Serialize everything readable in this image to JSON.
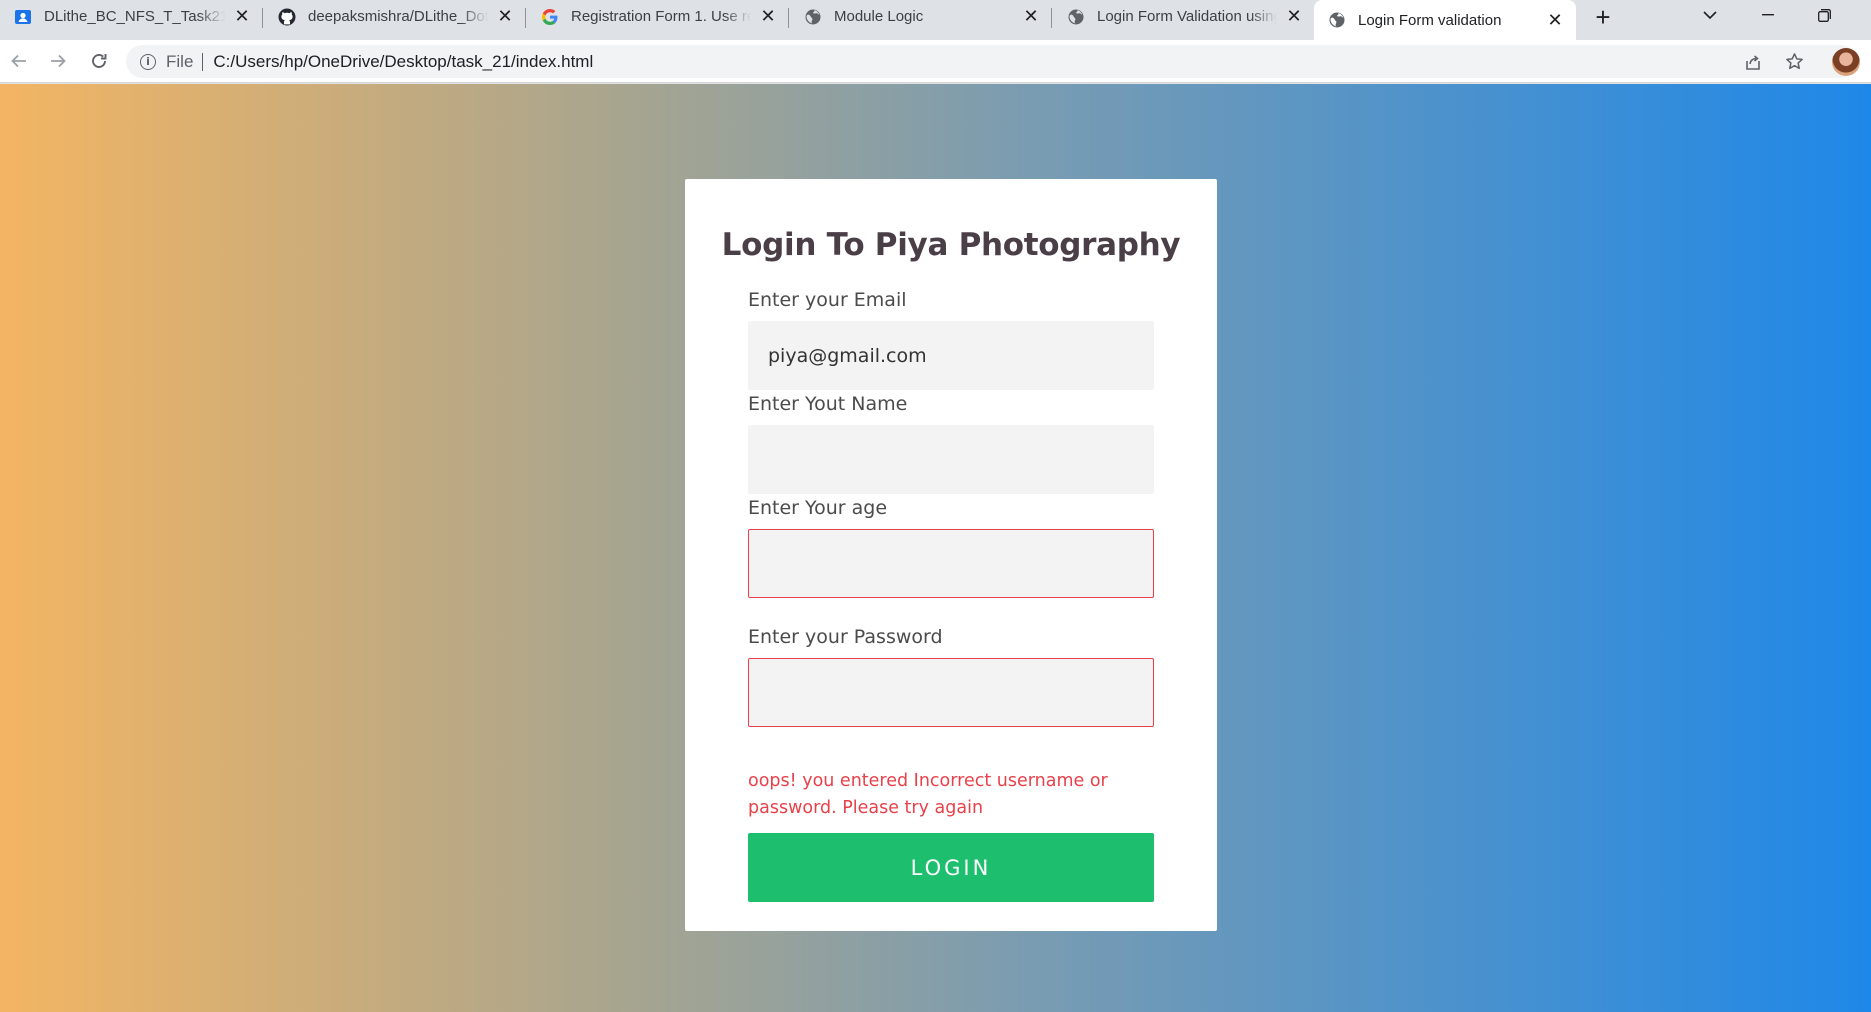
{
  "browser": {
    "tabs": [
      {
        "title": "DLithe_BC_NFS_T_Task21_Ja",
        "icon": "user-card-icon"
      },
      {
        "title": "deepaksmishra/DLithe_Dot",
        "icon": "github-icon"
      },
      {
        "title": "Registration Form 1. Use re",
        "icon": "google-icon"
      },
      {
        "title": "Module Logic",
        "icon": "globe-icon"
      },
      {
        "title": "Login Form Validation using",
        "icon": "globe-icon"
      },
      {
        "title": "Login Form validation",
        "icon": "globe-icon",
        "active": true
      }
    ],
    "address": {
      "scheme": "File",
      "url": "C:/Users/hp/OneDrive/Desktop/task_21/index.html"
    }
  },
  "page": {
    "title": "Login To Piya Photography",
    "fields": [
      {
        "label": "Enter your Email",
        "value": "piya@gmail.com",
        "invalid": false
      },
      {
        "label": "Enter Yout Name",
        "value": "",
        "invalid": false
      },
      {
        "label": "Enter Your age",
        "value": "",
        "invalid": true
      },
      {
        "label": "Enter your Password",
        "value": "",
        "invalid": true
      }
    ],
    "error_message": "oops! you entered Incorrect username or password. Please try again",
    "login_button": "LOGIN"
  },
  "colors": {
    "gradient_start": "#f3b563",
    "gradient_end": "#1e88e8",
    "error": "#e8414a",
    "button": "#1ebe6f",
    "title": "#4a3f46"
  }
}
